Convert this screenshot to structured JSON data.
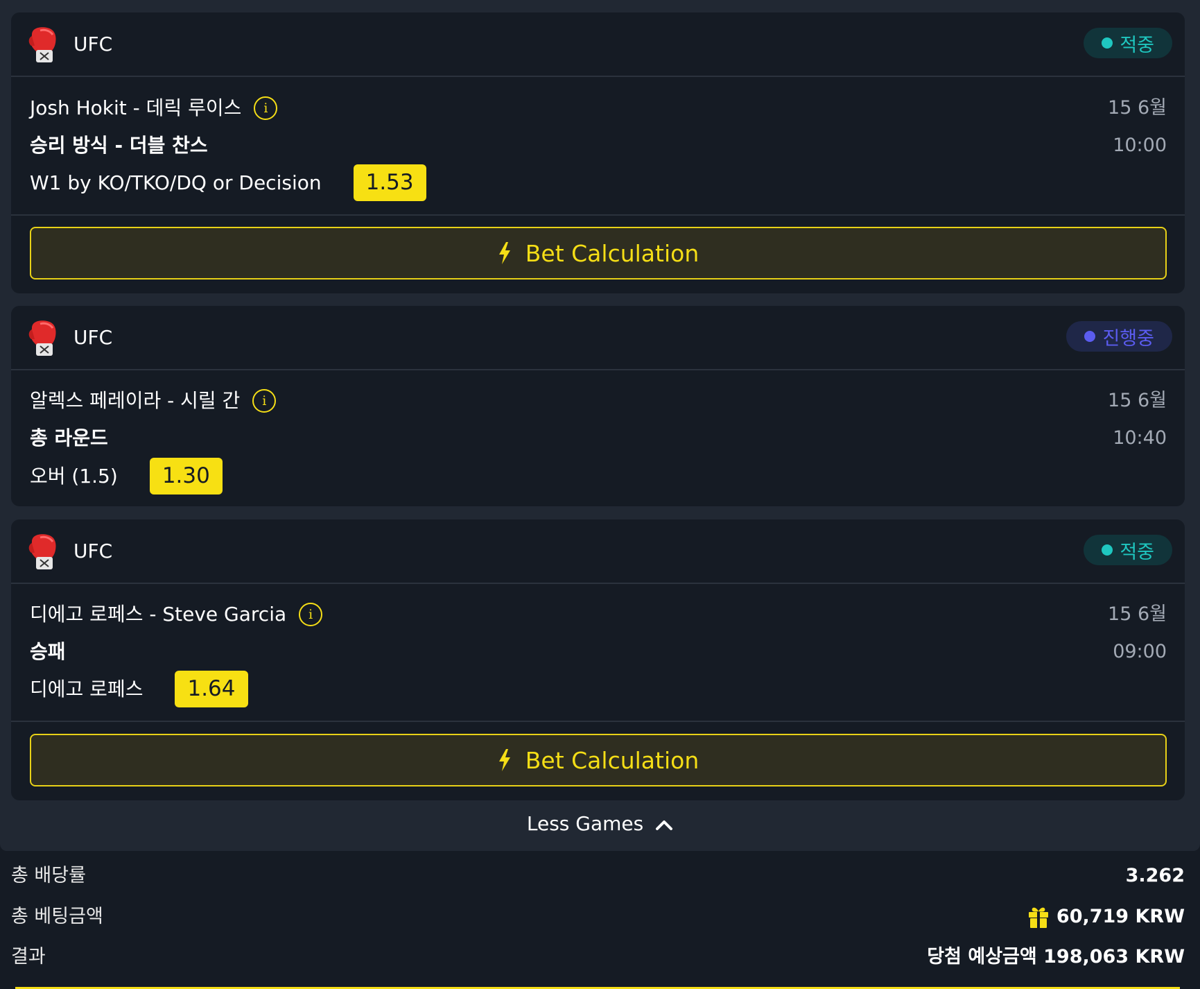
{
  "bets": [
    {
      "sport": "UFC",
      "status": "적중",
      "status_type": "win",
      "match": "Josh Hokit - 데릭 루이스",
      "date": "15 6월",
      "time": "10:00",
      "market": "승리 방식 - 더블 찬스",
      "pick": "W1 by KO/TKO/DQ or Decision",
      "odds": "1.53",
      "bet_button": "Bet Calculation"
    },
    {
      "sport": "UFC",
      "status": "진행중",
      "status_type": "live",
      "match": "알렉스 페레이라 - 시릴 간",
      "date": "15 6월",
      "time": "10:40",
      "market": "총 라운드",
      "pick": "오버 (1.5)",
      "odds": "1.30"
    },
    {
      "sport": "UFC",
      "status": "적중",
      "status_type": "win",
      "match": "디에고 로페스 - Steve Garcia",
      "date": "15 6월",
      "time": "09:00",
      "market": "승패",
      "pick": "디에고 로페스",
      "odds": "1.64",
      "bet_button": "Bet Calculation"
    }
  ],
  "less_games": "Less Games",
  "summary": {
    "total_odds_label": "총 배당률",
    "total_odds_value": "3.262",
    "total_stake_label": "총 베팅금액",
    "total_stake_value": "60,719 KRW",
    "result_label": "결과",
    "result_value": "당첨 예상금액 198,063 KRW"
  },
  "colors": {
    "accent": "#f7e013",
    "win": "#1fc7c0",
    "live": "#5b5cf0",
    "background": "#151b24",
    "panel": "#212833"
  },
  "icons": {
    "sport": "boxing-glove-icon",
    "info": "info-icon",
    "bet": "lightning-icon",
    "less": "chevron-up-icon",
    "gift": "gift-icon"
  }
}
